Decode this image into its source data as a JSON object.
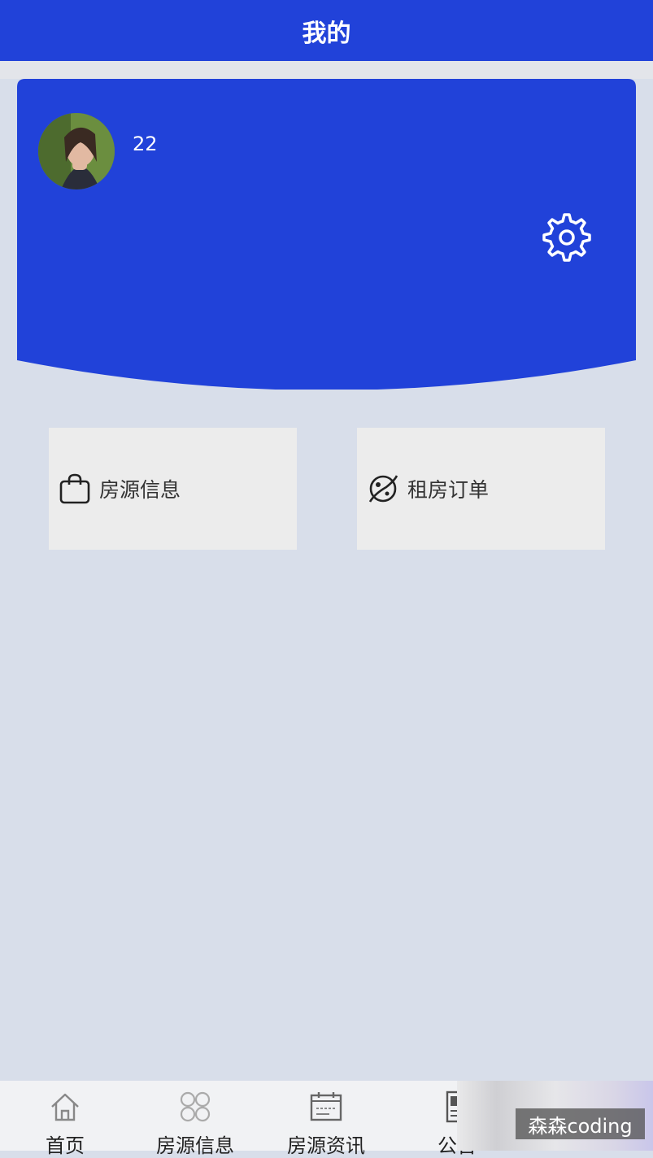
{
  "header": {
    "title": "我的"
  },
  "profile": {
    "username": "22",
    "brand_color": "#2142d9"
  },
  "menu": [
    {
      "label": "房源信息",
      "icon": "shopping-bag-icon"
    },
    {
      "label": "租房订单",
      "icon": "planet-icon"
    }
  ],
  "tabbar": {
    "items": [
      {
        "label": "首页",
        "icon": "home-icon"
      },
      {
        "label": "房源信息",
        "icon": "grid-icon"
      },
      {
        "label": "房源资讯",
        "icon": "calendar-icon"
      },
      {
        "label": "公告",
        "icon": "document-icon"
      }
    ]
  },
  "watermark": "森森coding"
}
